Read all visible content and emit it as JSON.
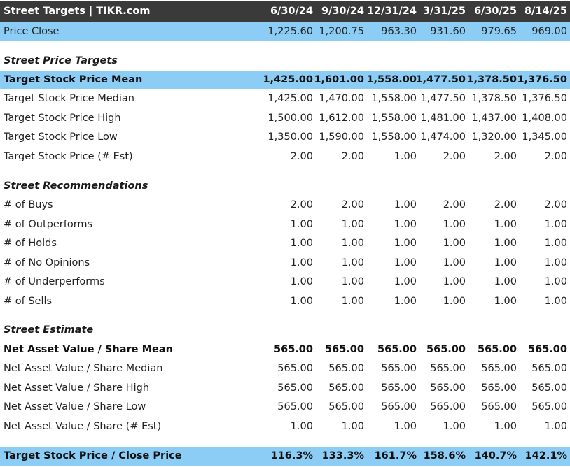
{
  "header": {
    "title": "Street Targets | TIKR.com",
    "dates": [
      "6/30/24",
      "9/30/24",
      "12/31/24",
      "3/31/25",
      "6/30/25",
      "8/14/25"
    ]
  },
  "price_close": {
    "label": "Price Close",
    "values": [
      "1,225.60",
      "1,200.75",
      "963.30",
      "931.60",
      "979.65",
      "969.00"
    ]
  },
  "sections": {
    "price_targets": "Street Price Targets",
    "recommendations": "Street Recommendations",
    "estimate": "Street Estimate"
  },
  "rows": {
    "target_mean": {
      "label": "Target Stock Price Mean",
      "values": [
        "1,425.00",
        "1,601.00",
        "1,558.00",
        "1,477.50",
        "1,378.50",
        "1,376.50"
      ]
    },
    "target_median": {
      "label": "Target Stock Price Median",
      "values": [
        "1,425.00",
        "1,470.00",
        "1,558.00",
        "1,477.50",
        "1,378.50",
        "1,376.50"
      ]
    },
    "target_high": {
      "label": "Target Stock Price High",
      "values": [
        "1,500.00",
        "1,612.00",
        "1,558.00",
        "1,481.00",
        "1,437.00",
        "1,408.00"
      ]
    },
    "target_low": {
      "label": "Target Stock Price Low",
      "values": [
        "1,350.00",
        "1,590.00",
        "1,558.00",
        "1,474.00",
        "1,320.00",
        "1,345.00"
      ]
    },
    "target_est": {
      "label": "Target Stock Price (# Est)",
      "values": [
        "2.00",
        "2.00",
        "1.00",
        "2.00",
        "2.00",
        "2.00"
      ]
    },
    "buys": {
      "label": "# of Buys",
      "values": [
        "2.00",
        "2.00",
        "1.00",
        "2.00",
        "2.00",
        "2.00"
      ]
    },
    "outperforms": {
      "label": "# of Outperforms",
      "values": [
        "1.00",
        "1.00",
        "1.00",
        "1.00",
        "1.00",
        "1.00"
      ]
    },
    "holds": {
      "label": "# of Holds",
      "values": [
        "1.00",
        "1.00",
        "1.00",
        "1.00",
        "1.00",
        "1.00"
      ]
    },
    "no_opinions": {
      "label": "# of No Opinions",
      "values": [
        "1.00",
        "1.00",
        "1.00",
        "1.00",
        "1.00",
        "1.00"
      ]
    },
    "underperforms": {
      "label": "# of Underperforms",
      "values": [
        "1.00",
        "1.00",
        "1.00",
        "1.00",
        "1.00",
        "1.00"
      ]
    },
    "sells": {
      "label": "# of Sells",
      "values": [
        "1.00",
        "1.00",
        "1.00",
        "1.00",
        "1.00",
        "1.00"
      ]
    },
    "nav_mean": {
      "label": "Net Asset Value / Share Mean",
      "values": [
        "565.00",
        "565.00",
        "565.00",
        "565.00",
        "565.00",
        "565.00"
      ]
    },
    "nav_median": {
      "label": "Net Asset Value / Share Median",
      "values": [
        "565.00",
        "565.00",
        "565.00",
        "565.00",
        "565.00",
        "565.00"
      ]
    },
    "nav_high": {
      "label": "Net Asset Value / Share High",
      "values": [
        "565.00",
        "565.00",
        "565.00",
        "565.00",
        "565.00",
        "565.00"
      ]
    },
    "nav_low": {
      "label": "Net Asset Value / Share Low",
      "values": [
        "565.00",
        "565.00",
        "565.00",
        "565.00",
        "565.00",
        "565.00"
      ]
    },
    "nav_est": {
      "label": "Net Asset Value / Share (# Est)",
      "values": [
        "1.00",
        "1.00",
        "1.00",
        "1.00",
        "1.00",
        "1.00"
      ]
    },
    "target_close_ratio": {
      "label": "Target Stock Price / Close Price",
      "values": [
        "116.3%",
        "133.3%",
        "161.7%",
        "158.6%",
        "140.7%",
        "142.1%"
      ]
    }
  },
  "colors": {
    "header_bg": "#3a3a3a",
    "highlight_blue": "#8ccdf6"
  }
}
